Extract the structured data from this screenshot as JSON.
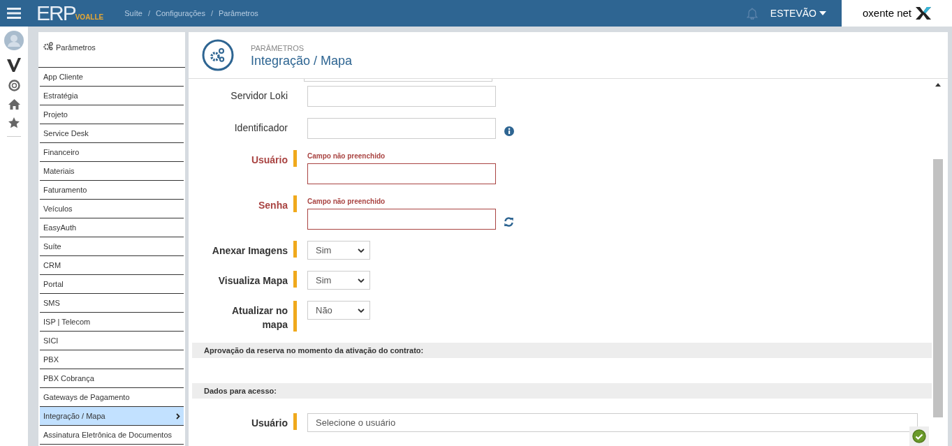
{
  "header": {
    "logo": "ERP",
    "logo_sub": "VOALLE",
    "breadcrumb": [
      {
        "kind": "link",
        "text": "Suíte"
      },
      {
        "kind": "separator",
        "text": "/"
      },
      {
        "kind": "link",
        "text": "Configurações"
      },
      {
        "kind": "separator",
        "text": "/"
      },
      {
        "kind": "link",
        "text": "Parâmetros"
      }
    ],
    "user": "ESTEVÃO",
    "brand": "oxente net"
  },
  "sidebar": {
    "title": "Parâmetros",
    "items": [
      {
        "label": "App Cliente",
        "selected": false
      },
      {
        "label": "Estratégia",
        "selected": false
      },
      {
        "label": "Projeto",
        "selected": false
      },
      {
        "label": "Service Desk",
        "selected": false
      },
      {
        "label": "Financeiro",
        "selected": false
      },
      {
        "label": "Materiais",
        "selected": false
      },
      {
        "label": "Faturamento",
        "selected": false
      },
      {
        "label": "Veículos",
        "selected": false
      },
      {
        "label": "EasyAuth",
        "selected": false
      },
      {
        "label": "Suíte",
        "selected": false
      },
      {
        "label": "CRM",
        "selected": false
      },
      {
        "label": "Portal",
        "selected": false
      },
      {
        "label": "SMS",
        "selected": false
      },
      {
        "label": "ISP | Telecom",
        "selected": false
      },
      {
        "label": "SICI",
        "selected": false
      },
      {
        "label": "PBX",
        "selected": false
      },
      {
        "label": "PBX Cobrança",
        "selected": false
      },
      {
        "label": "Gateways de Pagamento",
        "selected": false
      },
      {
        "label": "Integração / Mapa",
        "selected": true
      },
      {
        "label": "Assinatura Eletrônica de Documentos",
        "selected": false
      }
    ]
  },
  "page": {
    "overline": "PARÂMETROS",
    "title": "Integração / Mapa"
  },
  "form": [
    {
      "kind": "text",
      "label": "Servidor Loki",
      "required": false
    },
    {
      "kind": "text",
      "label": "Identificador",
      "required": false,
      "info_button": true
    },
    {
      "kind": "text",
      "label": "Usuário",
      "required": true,
      "error": "Campo não preenchido"
    },
    {
      "kind": "text",
      "label": "Senha",
      "required": true,
      "error": "Campo não preenchido",
      "refresh_button": true
    },
    {
      "kind": "select",
      "label": "Anexar Imagens",
      "required": true,
      "value": "Sim"
    },
    {
      "kind": "select",
      "label": "Visualiza Mapa",
      "required": true,
      "value": "Sim"
    },
    {
      "kind": "select",
      "label": "Atualizar no mapa",
      "required": true,
      "value": "Não"
    },
    {
      "kind": "section",
      "label": "Aprovação da reserva no momento da ativação do contrato:"
    },
    {
      "kind": "spacer"
    },
    {
      "kind": "section",
      "label": "Dados para acesso:"
    },
    {
      "kind": "wideselect",
      "label": "Usuário",
      "required": true,
      "value": "Selecione o usuário"
    }
  ]
}
